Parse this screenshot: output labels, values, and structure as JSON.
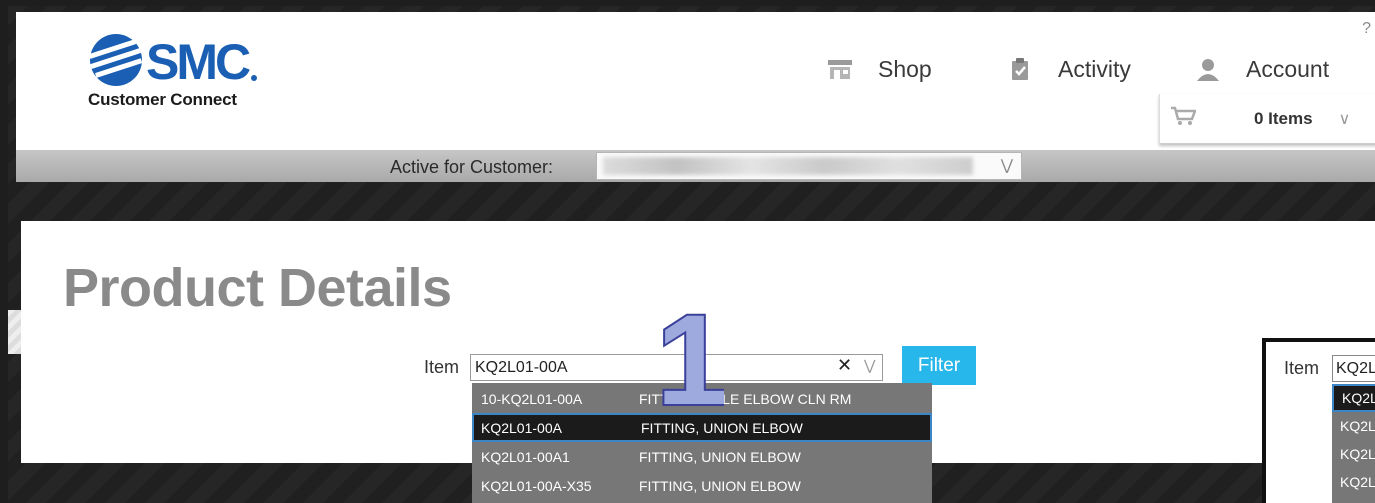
{
  "header": {
    "logo_tagline": "Customer Connect",
    "help_label": "?",
    "nav": [
      {
        "label": "Shop",
        "icon": "shop-icon"
      },
      {
        "label": "Activity",
        "icon": "clipboard-check-icon"
      },
      {
        "label": "Account",
        "icon": "user-icon"
      }
    ],
    "cart": {
      "label": "0 Items",
      "icon": "cart-icon"
    }
  },
  "customer_bar": {
    "label": "Active for Customer:",
    "value": ""
  },
  "main": {
    "title": "Product Details",
    "item_label": "Item",
    "item_value": "KQ2L01-00A",
    "clear_glyph": "✕",
    "filter_label": "Filter"
  },
  "suggestions": [
    {
      "code": "10-KQ2L01-00A",
      "desc": "FITTING, MALE ELBOW CLN RM"
    },
    {
      "code": "KQ2L01-00A",
      "desc": "FITTING, UNION ELBOW",
      "selected": true
    },
    {
      "code": "KQ2L01-00A1",
      "desc": "FITTING, UNION ELBOW"
    },
    {
      "code": "KQ2L01-00A-X35",
      "desc": "FITTING, UNION ELBOW"
    }
  ],
  "callout_number": "1",
  "inset": {
    "item_label": "Item",
    "input_value": "KQ2L",
    "rows": [
      "KQ2L",
      "KQ2L",
      "KQ2L",
      "KQ2L"
    ]
  },
  "colors": {
    "accent": "#27b7ea",
    "logo_blue": "#1a5fb4",
    "selection_border": "#3c86c5"
  }
}
